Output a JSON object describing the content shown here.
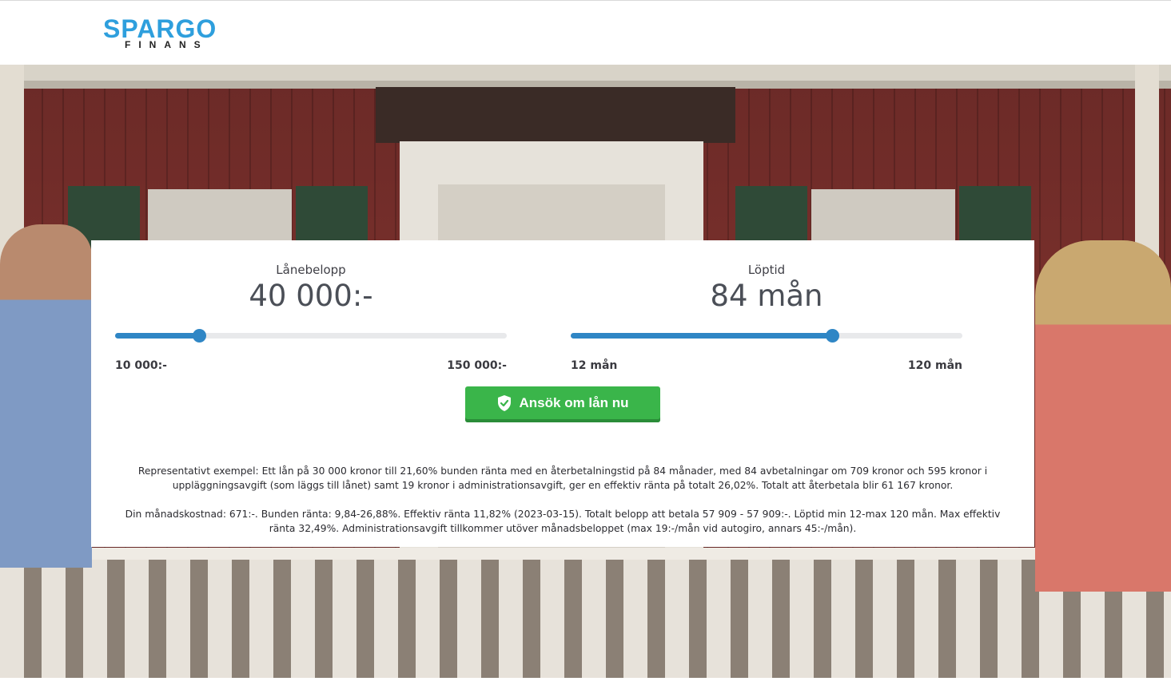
{
  "brand": {
    "name": "SPARGO",
    "sub": "FINANS",
    "color": "#2e9fdd"
  },
  "calculator": {
    "amount": {
      "label": "Lånebelopp",
      "value": "40 000:-",
      "min": "10 000:-",
      "max": "150 000:-",
      "level": 0.214
    },
    "term": {
      "label": "Löptid",
      "value": "84 mån",
      "min": "12 mån",
      "max": "120 mån",
      "level": 0.667
    },
    "apply_button": {
      "label": "Ansök om lån nu",
      "icon": "shield-check-icon",
      "color": "#3ab54a"
    },
    "slider_color": "#2f86c5"
  },
  "legal": {
    "example": "Representativt exempel: Ett lån på 30 000 kronor till 21,60% bunden ränta med en återbetalningstid på 84 månader, med 84 avbetalningar om 709 kronor och 595 kronor i uppläggningsavgift (som läggs till lånet) samt 19 kronor i administrationsavgift, ger en effektiv ränta på totalt 26,02%. Totalt att återbetala blir 61 167 kronor.",
    "monthly": "Din månadskostnad: 671:-. Bunden ränta: 9,84-26,88%. Effektiv ränta 11,82% (2023-03-15). Totalt belopp att betala 57 909 - 57 909:-. Löptid min 12-max 120 mån. Max effektiv ränta 32,49%. Administrationsavgift tillkommer utöver månadsbeloppet (max 19:-/mån vid autogiro, annars 45:-/mån)."
  }
}
